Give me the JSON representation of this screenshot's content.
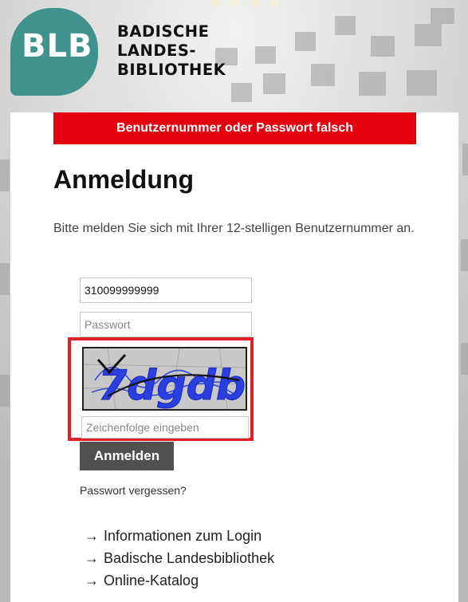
{
  "header": {
    "logo_abbr": "BLB",
    "brand_lines": [
      "BADISCHE",
      "LANDES-",
      "BIBLIOTHEK"
    ]
  },
  "alert": {
    "message": "Benutzernummer oder Passwort falsch"
  },
  "login": {
    "title": "Anmeldung",
    "intro": "Bitte melden Sie sich mit Ihrer 12-stelligen Benutzernummer an.",
    "username_value": "310099999999",
    "password_placeholder": "Passwort",
    "captcha_text": "7dgdb",
    "captcha_placeholder": "Zeichenfolge eingeben",
    "submit_label": "Anmelden",
    "forgot_label": "Passwort vergessen?"
  },
  "links": [
    {
      "arrow": "→",
      "label": "Informationen zum Login"
    },
    {
      "arrow": "→",
      "label": "Badische Landesbibliothek"
    },
    {
      "arrow": "→",
      "label": "Online-Katalog"
    }
  ],
  "colors": {
    "logo_teal": "#3f938c",
    "error_red": "#e3000f",
    "button_gray": "#505050"
  }
}
